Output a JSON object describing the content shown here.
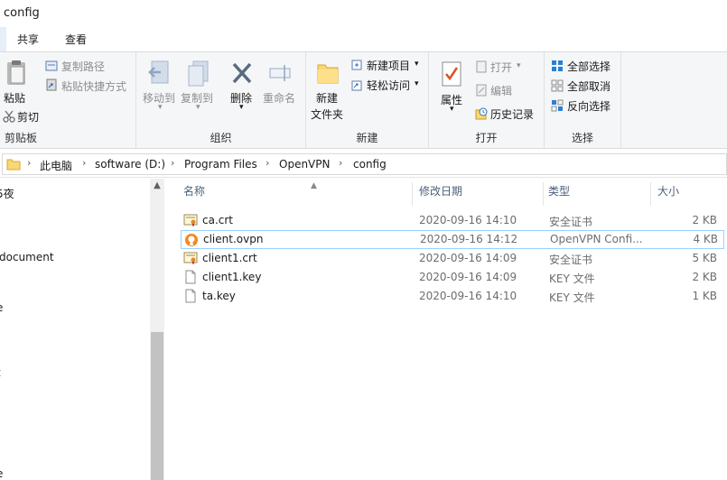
{
  "window": {
    "title": "config"
  },
  "ribbon_tabs": [
    "共享",
    "查看"
  ],
  "ribbon": {
    "clipboard": {
      "label": "剪贴板",
      "paste": "粘贴",
      "copy_path": "复制路径",
      "paste_shortcut": "粘贴快捷方式",
      "cut": "剪切"
    },
    "organize": {
      "label": "组织",
      "move_to": "移动到",
      "copy_to": "复制到",
      "delete": "删除",
      "rename": "重命名"
    },
    "new": {
      "label": "新建",
      "new_folder_line1": "新建",
      "new_folder_line2": "文件夹",
      "new_item": "新建项目",
      "easy_access": "轻松访问"
    },
    "open": {
      "label": "打开",
      "properties": "属性",
      "open": "打开",
      "edit": "编辑",
      "history": "历史记录"
    },
    "select": {
      "label": "选择",
      "select_all": "全部选择",
      "select_none": "全部取消",
      "invert": "反向选择"
    }
  },
  "address": {
    "crumbs": [
      "此电脑",
      "software (D:)",
      "Program Files",
      "OpenVPN",
      "config"
    ]
  },
  "nav": {
    "items": [
      "5夜",
      "document",
      "e",
      "t",
      "e"
    ]
  },
  "columns": {
    "name": "名称",
    "modified": "修改日期",
    "type": "类型",
    "size": "大小"
  },
  "files": [
    {
      "name": "ca.crt",
      "modified": "2020-09-16 14:10",
      "type": "安全证书",
      "size": "2 KB",
      "icon": "certificate-icon"
    },
    {
      "name": "client.ovpn",
      "modified": "2020-09-16 14:12",
      "type": "OpenVPN Confi...",
      "size": "4 KB",
      "icon": "openvpn-icon"
    },
    {
      "name": "client1.crt",
      "modified": "2020-09-16 14:09",
      "type": "安全证书",
      "size": "5 KB",
      "icon": "certificate-icon"
    },
    {
      "name": "client1.key",
      "modified": "2020-09-16 14:09",
      "type": "KEY 文件",
      "size": "2 KB",
      "icon": "file-icon"
    },
    {
      "name": "ta.key",
      "modified": "2020-09-16 14:10",
      "type": "KEY 文件",
      "size": "1 KB",
      "icon": "file-icon"
    }
  ],
  "colors": {
    "accent": "#0078d7",
    "selection_border": "#99d1ff",
    "ribbon_bg": "#f5f6f7"
  }
}
